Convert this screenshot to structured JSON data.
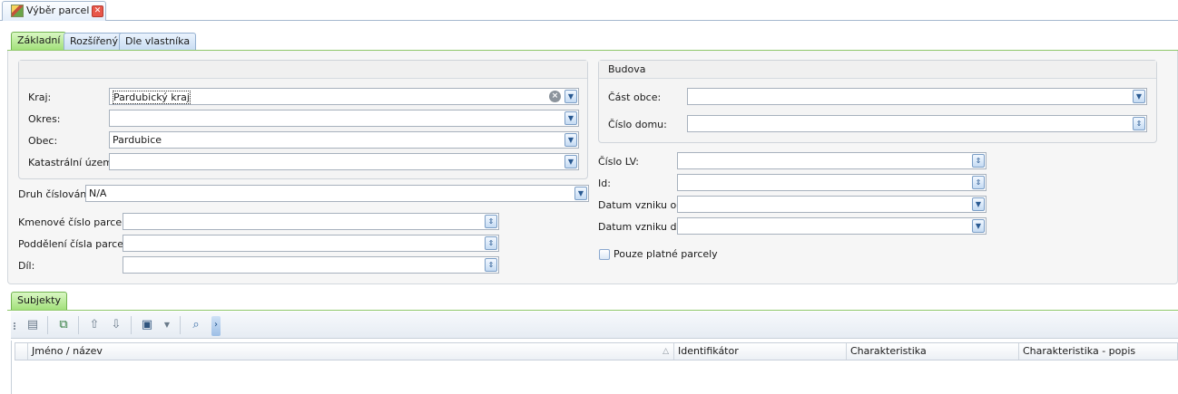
{
  "window_tab": {
    "title": "Výběr parcel",
    "close": "✕"
  },
  "tabs": [
    "Základní",
    "Rozšířený",
    "Dle vlastníka"
  ],
  "location": {
    "kraj": {
      "label": "Kraj:",
      "value": "Pardubický kraj"
    },
    "okres": {
      "label": "Okres:",
      "value": ""
    },
    "obec": {
      "label": "Obec:",
      "value": "Pardubice"
    },
    "ku": {
      "label": "Katastrální území:",
      "value": ""
    }
  },
  "druh": {
    "label": "Druh číslování:",
    "value": "N/A"
  },
  "parcela": {
    "kmenove": {
      "label": "Kmenové číslo parcely:",
      "value": ""
    },
    "podd": {
      "label": "Poddělení čísla parcely:",
      "value": ""
    },
    "dil": {
      "label": "Díl:",
      "value": ""
    }
  },
  "budova": {
    "title": "Budova",
    "cast_obce": {
      "label": "Část obce:",
      "value": ""
    },
    "cislo_domu": {
      "label": "Číslo domu:",
      "value": ""
    }
  },
  "right": {
    "cislo_lv": {
      "label": "Číslo LV:",
      "value": ""
    },
    "id": {
      "label": "Id:",
      "value": ""
    },
    "vznik_od": {
      "label": "Datum vzniku od:",
      "value": ""
    },
    "vznik_do": {
      "label": "Datum vzniku do:",
      "value": ""
    },
    "platne": {
      "label": "Pouze platné parcely",
      "checked": false
    }
  },
  "subjects": {
    "tab": "Subjekty",
    "columns": [
      "Jméno / název",
      "Identifikátor",
      "Charakteristika",
      "Charakteristika - popis"
    ]
  },
  "colors": {
    "accent_green": "#9fdf76",
    "tab_blue": "#c9ddf3",
    "field_border": "#a7b1bd"
  }
}
